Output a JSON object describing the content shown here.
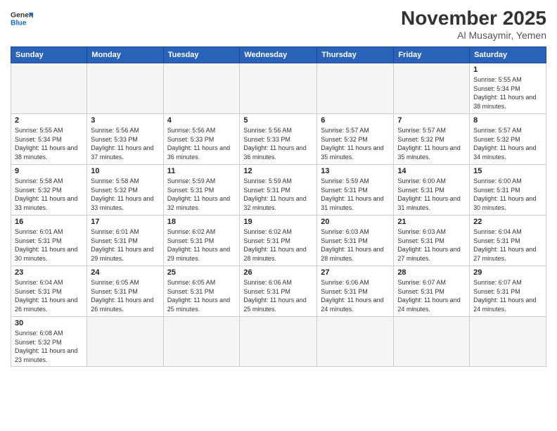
{
  "logo": {
    "text_general": "General",
    "text_blue": "Blue"
  },
  "header": {
    "month": "November 2025",
    "location": "Al Musaymir, Yemen"
  },
  "weekdays": [
    "Sunday",
    "Monday",
    "Tuesday",
    "Wednesday",
    "Thursday",
    "Friday",
    "Saturday"
  ],
  "weeks": [
    [
      {
        "day": "",
        "empty": true
      },
      {
        "day": "",
        "empty": true
      },
      {
        "day": "",
        "empty": true
      },
      {
        "day": "",
        "empty": true
      },
      {
        "day": "",
        "empty": true
      },
      {
        "day": "",
        "empty": true
      },
      {
        "day": "1",
        "sunrise": "5:55 AM",
        "sunset": "5:34 PM",
        "daylight": "11 hours and 38 minutes."
      }
    ],
    [
      {
        "day": "2",
        "sunrise": "5:55 AM",
        "sunset": "5:34 PM",
        "daylight": "11 hours and 38 minutes."
      },
      {
        "day": "3",
        "sunrise": "5:56 AM",
        "sunset": "5:33 PM",
        "daylight": "11 hours and 37 minutes."
      },
      {
        "day": "4",
        "sunrise": "5:56 AM",
        "sunset": "5:33 PM",
        "daylight": "11 hours and 36 minutes."
      },
      {
        "day": "5",
        "sunrise": "5:56 AM",
        "sunset": "5:33 PM",
        "daylight": "11 hours and 36 minutes."
      },
      {
        "day": "6",
        "sunrise": "5:57 AM",
        "sunset": "5:32 PM",
        "daylight": "11 hours and 35 minutes."
      },
      {
        "day": "7",
        "sunrise": "5:57 AM",
        "sunset": "5:32 PM",
        "daylight": "11 hours and 35 minutes."
      },
      {
        "day": "8",
        "sunrise": "5:57 AM",
        "sunset": "5:32 PM",
        "daylight": "11 hours and 34 minutes."
      }
    ],
    [
      {
        "day": "9",
        "sunrise": "5:58 AM",
        "sunset": "5:32 PM",
        "daylight": "11 hours and 33 minutes."
      },
      {
        "day": "10",
        "sunrise": "5:58 AM",
        "sunset": "5:32 PM",
        "daylight": "11 hours and 33 minutes."
      },
      {
        "day": "11",
        "sunrise": "5:59 AM",
        "sunset": "5:31 PM",
        "daylight": "11 hours and 32 minutes."
      },
      {
        "day": "12",
        "sunrise": "5:59 AM",
        "sunset": "5:31 PM",
        "daylight": "11 hours and 32 minutes."
      },
      {
        "day": "13",
        "sunrise": "5:59 AM",
        "sunset": "5:31 PM",
        "daylight": "11 hours and 31 minutes."
      },
      {
        "day": "14",
        "sunrise": "6:00 AM",
        "sunset": "5:31 PM",
        "daylight": "11 hours and 31 minutes."
      },
      {
        "day": "15",
        "sunrise": "6:00 AM",
        "sunset": "5:31 PM",
        "daylight": "11 hours and 30 minutes."
      }
    ],
    [
      {
        "day": "16",
        "sunrise": "6:01 AM",
        "sunset": "5:31 PM",
        "daylight": "11 hours and 30 minutes."
      },
      {
        "day": "17",
        "sunrise": "6:01 AM",
        "sunset": "5:31 PM",
        "daylight": "11 hours and 29 minutes."
      },
      {
        "day": "18",
        "sunrise": "6:02 AM",
        "sunset": "5:31 PM",
        "daylight": "11 hours and 29 minutes."
      },
      {
        "day": "19",
        "sunrise": "6:02 AM",
        "sunset": "5:31 PM",
        "daylight": "11 hours and 28 minutes."
      },
      {
        "day": "20",
        "sunrise": "6:03 AM",
        "sunset": "5:31 PM",
        "daylight": "11 hours and 28 minutes."
      },
      {
        "day": "21",
        "sunrise": "6:03 AM",
        "sunset": "5:31 PM",
        "daylight": "11 hours and 27 minutes."
      },
      {
        "day": "22",
        "sunrise": "6:04 AM",
        "sunset": "5:31 PM",
        "daylight": "11 hours and 27 minutes."
      }
    ],
    [
      {
        "day": "23",
        "sunrise": "6:04 AM",
        "sunset": "5:31 PM",
        "daylight": "11 hours and 26 minutes."
      },
      {
        "day": "24",
        "sunrise": "6:05 AM",
        "sunset": "5:31 PM",
        "daylight": "11 hours and 26 minutes."
      },
      {
        "day": "25",
        "sunrise": "6:05 AM",
        "sunset": "5:31 PM",
        "daylight": "11 hours and 25 minutes."
      },
      {
        "day": "26",
        "sunrise": "6:06 AM",
        "sunset": "5:31 PM",
        "daylight": "11 hours and 25 minutes."
      },
      {
        "day": "27",
        "sunrise": "6:06 AM",
        "sunset": "5:31 PM",
        "daylight": "11 hours and 24 minutes."
      },
      {
        "day": "28",
        "sunrise": "6:07 AM",
        "sunset": "5:31 PM",
        "daylight": "11 hours and 24 minutes."
      },
      {
        "day": "29",
        "sunrise": "6:07 AM",
        "sunset": "5:31 PM",
        "daylight": "11 hours and 24 minutes."
      }
    ],
    [
      {
        "day": "30",
        "sunrise": "6:08 AM",
        "sunset": "5:32 PM",
        "daylight": "11 hours and 23 minutes."
      },
      {
        "day": "",
        "empty": true
      },
      {
        "day": "",
        "empty": true
      },
      {
        "day": "",
        "empty": true
      },
      {
        "day": "",
        "empty": true
      },
      {
        "day": "",
        "empty": true
      },
      {
        "day": "",
        "empty": true
      }
    ]
  ]
}
